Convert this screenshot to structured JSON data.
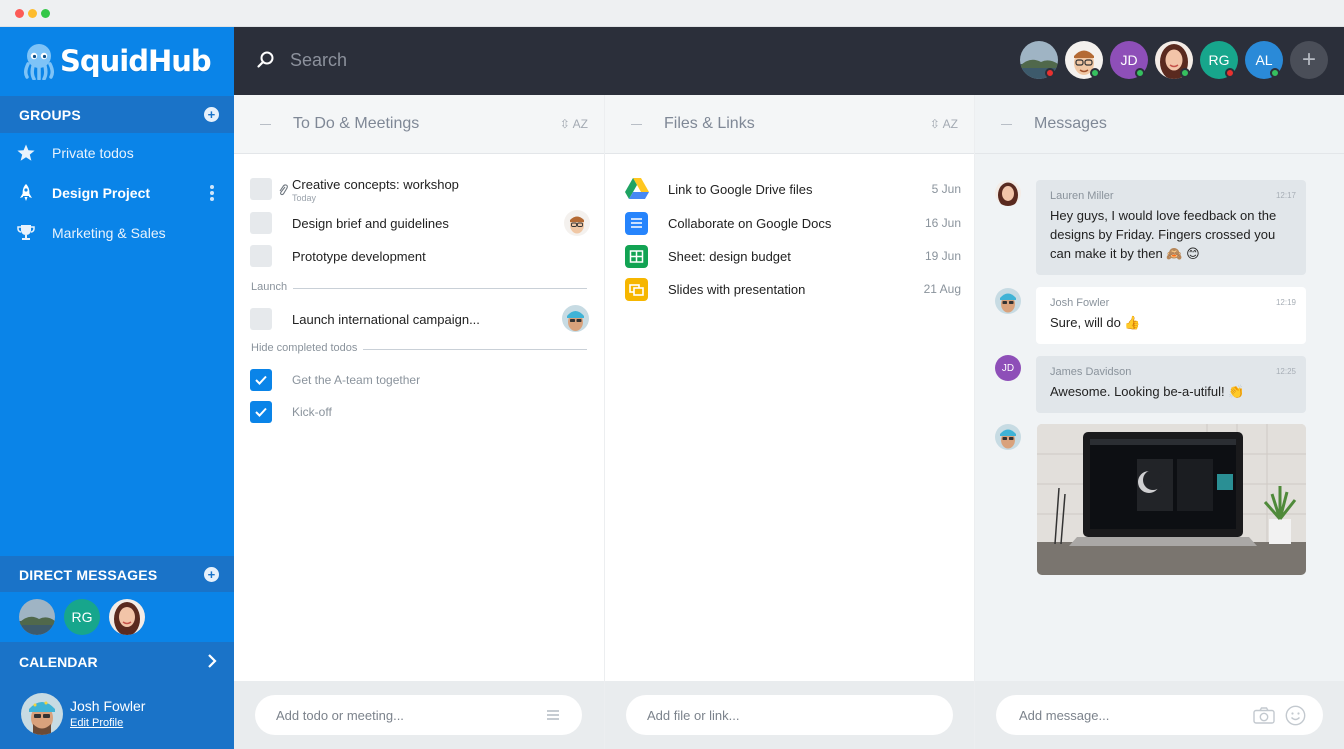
{
  "app": {
    "name": "SquidHub"
  },
  "sidebar": {
    "groups_label": "GROUPS",
    "items": [
      {
        "label": "Private todos",
        "icon": "star-icon"
      },
      {
        "label": "Design Project",
        "icon": "rocket-icon",
        "active": true
      },
      {
        "label": "Marketing & Sales",
        "icon": "trophy-icon"
      }
    ],
    "direct_messages_label": "DIRECT MESSAGES",
    "dm_avatars": [
      "landscape-avatar",
      "RG",
      "woman-avatar"
    ],
    "calendar_label": "CALENDAR",
    "profile": {
      "name": "Josh Fowler",
      "edit_label": "Edit Profile"
    }
  },
  "topbar": {
    "search_placeholder": "Search",
    "members": [
      {
        "type": "photo",
        "icon": "landscape-avatar",
        "status": "busy"
      },
      {
        "type": "photo",
        "icon": "man-glasses-avatar",
        "status": "online"
      },
      {
        "type": "initials",
        "initials": "JD",
        "color": "#8e4fb8",
        "status": "online"
      },
      {
        "type": "photo",
        "icon": "woman-avatar",
        "status": "online"
      },
      {
        "type": "initials",
        "initials": "RG",
        "color": "#17a68c",
        "status": "busy"
      },
      {
        "type": "initials",
        "initials": "AL",
        "color": "#2a8ad8",
        "status": "online"
      }
    ],
    "add_label": "+"
  },
  "todos": {
    "title": "To Do & Meetings",
    "sort_label": "AZ",
    "items": [
      {
        "text": "Creative concepts: workshop",
        "sub": "Today",
        "attachment": true
      },
      {
        "text": "Design brief and guidelines"
      },
      {
        "text": "Prototype development"
      }
    ],
    "launch_label": "Launch",
    "launch_items": [
      {
        "text": "Launch international campaign..."
      }
    ],
    "completed_label": "Hide completed todos",
    "completed_items": [
      {
        "text": "Get the A-team together"
      },
      {
        "text": "Kick-off"
      }
    ],
    "input_placeholder": "Add todo or meeting..."
  },
  "files": {
    "title": "Files & Links",
    "sort_label": "AZ",
    "items": [
      {
        "name": "Link to Google Drive files",
        "date": "5 Jun",
        "icon": "google-drive-icon"
      },
      {
        "name": "Collaborate on Google Docs",
        "date": "16 Jun",
        "icon": "google-docs-icon"
      },
      {
        "name": "Sheet: design budget",
        "date": "19 Jun",
        "icon": "google-sheets-icon"
      },
      {
        "name": "Slides with presentation",
        "date": "21 Aug",
        "icon": "google-slides-icon"
      }
    ],
    "input_placeholder": "Add file or link..."
  },
  "messages": {
    "title": "Messages",
    "items": [
      {
        "author": "Lauren Miller",
        "time": "12:17",
        "text": "Hey guys, I would love feedback on the designs by Friday. Fingers crossed you can make it by then 🙈 😊"
      },
      {
        "author": "Josh Fowler",
        "time": "12:19",
        "text": "Sure, will do 👍"
      },
      {
        "author": "James Davidson",
        "time": "12:25",
        "text": "Awesome. Looking be-a-utiful! 👏",
        "avatar_initials": "JD"
      }
    ],
    "input_placeholder": "Add message..."
  },
  "colors": {
    "sidebar": "#0a84e8",
    "sidebar_dark": "#1a73c8",
    "topbar": "#2b2f3a",
    "accent": "#0a84e8"
  }
}
